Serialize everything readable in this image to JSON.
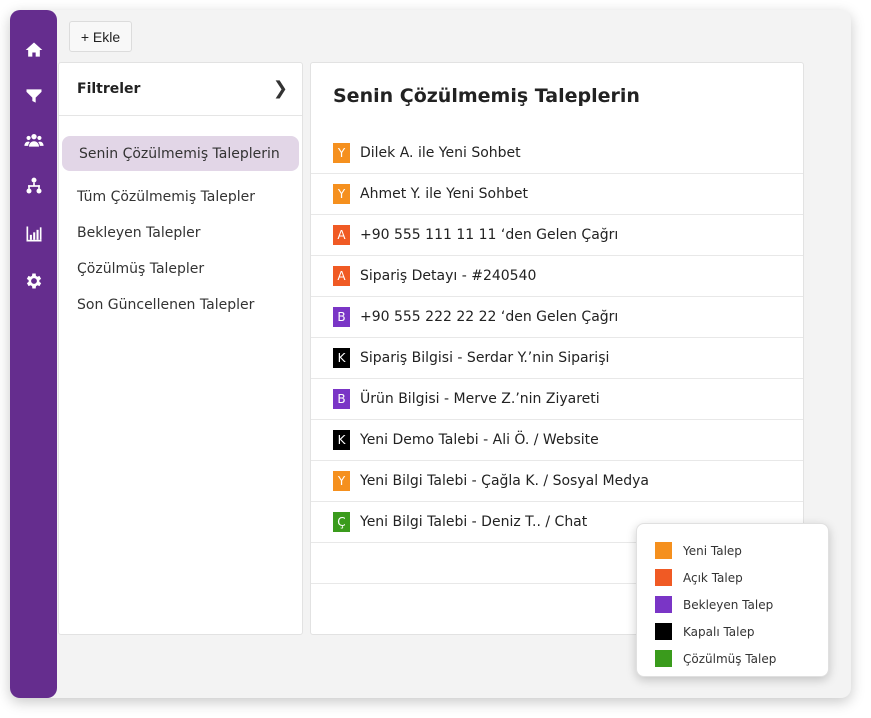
{
  "sidebar": {
    "icons": [
      "home-icon",
      "filter-icon",
      "users-icon",
      "hierarchy-icon",
      "bar-chart-icon",
      "gear-icon"
    ]
  },
  "toolbar": {
    "add_label": "+ Ekle"
  },
  "filters": {
    "title": "Filtreler",
    "items": [
      {
        "label": "Senin Çözülmemiş Taleplerin",
        "active": true
      },
      {
        "label": "Tüm Çözülmemiş Talepler"
      },
      {
        "label": "Bekleyen Talepler"
      },
      {
        "label": "Çözülmüş Talepler"
      },
      {
        "label": "Son Güncellenen Talepler"
      }
    ]
  },
  "main": {
    "title": "Senin Çözülmemiş Taleplerin",
    "tickets": [
      {
        "badge": "Y",
        "color": "#f5901e",
        "text": "Dilek A. ile Yeni Sohbet"
      },
      {
        "badge": "Y",
        "color": "#f5901e",
        "text": "Ahmet Y. ile Yeni Sohbet"
      },
      {
        "badge": "A",
        "color": "#f05a24",
        "text": "+90 555 111 11 11 ‘den Gelen Çağrı"
      },
      {
        "badge": "A",
        "color": "#f05a24",
        "text": "Sipariş Detayı - #240540"
      },
      {
        "badge": "B",
        "color": "#7a35c6",
        "text": "+90 555 222 22 22 ‘den Gelen Çağrı"
      },
      {
        "badge": "K",
        "color": "#000000",
        "text": "Sipariş Bilgisi - Serdar Y.’nin Siparişi"
      },
      {
        "badge": "B",
        "color": "#7a35c6",
        "text": "Ürün Bilgisi - Merve Z.’nin Ziyareti"
      },
      {
        "badge": "K",
        "color": "#000000",
        "text": "Yeni Demo Talebi - Ali Ö. / Website"
      },
      {
        "badge": "Y",
        "color": "#f5901e",
        "text": "Yeni Bilgi Talebi - Çağla K. / Sosyal Medya"
      },
      {
        "badge": "Ç",
        "color": "#3a9b1c",
        "text": "Yeni Bilgi Talebi - Deniz T.. / Chat"
      }
    ]
  },
  "legend": {
    "items": [
      {
        "label": "Yeni Talep",
        "color": "#f5901e"
      },
      {
        "label": "Açık Talep",
        "color": "#f05a24"
      },
      {
        "label": "Bekleyen Talep",
        "color": "#7a35c6"
      },
      {
        "label": "Kapalı Talep",
        "color": "#000000"
      },
      {
        "label": "Çözülmüş Talep",
        "color": "#3a9b1c"
      }
    ]
  }
}
